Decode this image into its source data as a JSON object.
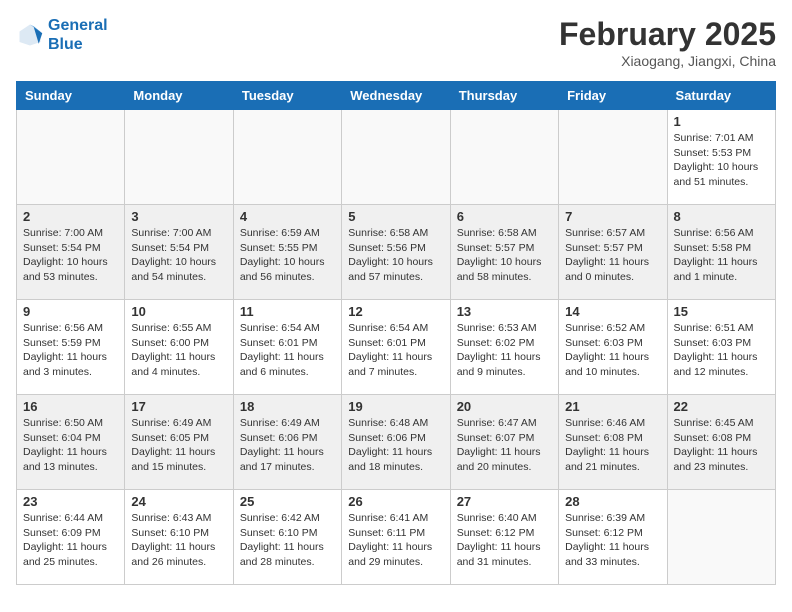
{
  "header": {
    "logo_line1": "General",
    "logo_line2": "Blue",
    "month": "February 2025",
    "location": "Xiaogang, Jiangxi, China"
  },
  "weekdays": [
    "Sunday",
    "Monday",
    "Tuesday",
    "Wednesday",
    "Thursday",
    "Friday",
    "Saturday"
  ],
  "weeks": [
    [
      {
        "day": "",
        "info": ""
      },
      {
        "day": "",
        "info": ""
      },
      {
        "day": "",
        "info": ""
      },
      {
        "day": "",
        "info": ""
      },
      {
        "day": "",
        "info": ""
      },
      {
        "day": "",
        "info": ""
      },
      {
        "day": "1",
        "info": "Sunrise: 7:01 AM\nSunset: 5:53 PM\nDaylight: 10 hours and 51 minutes."
      }
    ],
    [
      {
        "day": "2",
        "info": "Sunrise: 7:00 AM\nSunset: 5:54 PM\nDaylight: 10 hours and 53 minutes."
      },
      {
        "day": "3",
        "info": "Sunrise: 7:00 AM\nSunset: 5:54 PM\nDaylight: 10 hours and 54 minutes."
      },
      {
        "day": "4",
        "info": "Sunrise: 6:59 AM\nSunset: 5:55 PM\nDaylight: 10 hours and 56 minutes."
      },
      {
        "day": "5",
        "info": "Sunrise: 6:58 AM\nSunset: 5:56 PM\nDaylight: 10 hours and 57 minutes."
      },
      {
        "day": "6",
        "info": "Sunrise: 6:58 AM\nSunset: 5:57 PM\nDaylight: 10 hours and 58 minutes."
      },
      {
        "day": "7",
        "info": "Sunrise: 6:57 AM\nSunset: 5:57 PM\nDaylight: 11 hours and 0 minutes."
      },
      {
        "day": "8",
        "info": "Sunrise: 6:56 AM\nSunset: 5:58 PM\nDaylight: 11 hours and 1 minute."
      }
    ],
    [
      {
        "day": "9",
        "info": "Sunrise: 6:56 AM\nSunset: 5:59 PM\nDaylight: 11 hours and 3 minutes."
      },
      {
        "day": "10",
        "info": "Sunrise: 6:55 AM\nSunset: 6:00 PM\nDaylight: 11 hours and 4 minutes."
      },
      {
        "day": "11",
        "info": "Sunrise: 6:54 AM\nSunset: 6:01 PM\nDaylight: 11 hours and 6 minutes."
      },
      {
        "day": "12",
        "info": "Sunrise: 6:54 AM\nSunset: 6:01 PM\nDaylight: 11 hours and 7 minutes."
      },
      {
        "day": "13",
        "info": "Sunrise: 6:53 AM\nSunset: 6:02 PM\nDaylight: 11 hours and 9 minutes."
      },
      {
        "day": "14",
        "info": "Sunrise: 6:52 AM\nSunset: 6:03 PM\nDaylight: 11 hours and 10 minutes."
      },
      {
        "day": "15",
        "info": "Sunrise: 6:51 AM\nSunset: 6:03 PM\nDaylight: 11 hours and 12 minutes."
      }
    ],
    [
      {
        "day": "16",
        "info": "Sunrise: 6:50 AM\nSunset: 6:04 PM\nDaylight: 11 hours and 13 minutes."
      },
      {
        "day": "17",
        "info": "Sunrise: 6:49 AM\nSunset: 6:05 PM\nDaylight: 11 hours and 15 minutes."
      },
      {
        "day": "18",
        "info": "Sunrise: 6:49 AM\nSunset: 6:06 PM\nDaylight: 11 hours and 17 minutes."
      },
      {
        "day": "19",
        "info": "Sunrise: 6:48 AM\nSunset: 6:06 PM\nDaylight: 11 hours and 18 minutes."
      },
      {
        "day": "20",
        "info": "Sunrise: 6:47 AM\nSunset: 6:07 PM\nDaylight: 11 hours and 20 minutes."
      },
      {
        "day": "21",
        "info": "Sunrise: 6:46 AM\nSunset: 6:08 PM\nDaylight: 11 hours and 21 minutes."
      },
      {
        "day": "22",
        "info": "Sunrise: 6:45 AM\nSunset: 6:08 PM\nDaylight: 11 hours and 23 minutes."
      }
    ],
    [
      {
        "day": "23",
        "info": "Sunrise: 6:44 AM\nSunset: 6:09 PM\nDaylight: 11 hours and 25 minutes."
      },
      {
        "day": "24",
        "info": "Sunrise: 6:43 AM\nSunset: 6:10 PM\nDaylight: 11 hours and 26 minutes."
      },
      {
        "day": "25",
        "info": "Sunrise: 6:42 AM\nSunset: 6:10 PM\nDaylight: 11 hours and 28 minutes."
      },
      {
        "day": "26",
        "info": "Sunrise: 6:41 AM\nSunset: 6:11 PM\nDaylight: 11 hours and 29 minutes."
      },
      {
        "day": "27",
        "info": "Sunrise: 6:40 AM\nSunset: 6:12 PM\nDaylight: 11 hours and 31 minutes."
      },
      {
        "day": "28",
        "info": "Sunrise: 6:39 AM\nSunset: 6:12 PM\nDaylight: 11 hours and 33 minutes."
      },
      {
        "day": "",
        "info": ""
      }
    ]
  ]
}
